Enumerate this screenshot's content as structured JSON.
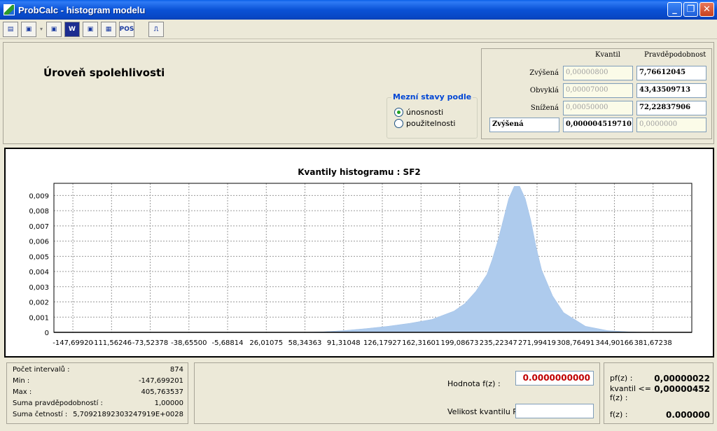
{
  "window": {
    "title": "ProbCalc - histogram modelu"
  },
  "toolbar": {
    "buttons": [
      "new-file-icon",
      "save-icon",
      "save-as-icon",
      "wiki-icon",
      "save-blue-icon",
      "report-icon",
      "pos-icon",
      "exit-icon"
    ],
    "pos_label": "POS"
  },
  "heading": "Úroveň spolehlivosti",
  "limit_states": {
    "title": "Mezní stavy podle",
    "options": [
      {
        "label": "únosnosti",
        "selected": true
      },
      {
        "label": "použitelnosti",
        "selected": false
      }
    ]
  },
  "quantile_table": {
    "col_kvantil": "Kvantil",
    "col_prob": "Pravděpodobnost",
    "rows": [
      {
        "label": "Zvýšená",
        "kvantil": "0,00000800",
        "prob": "7,76612045"
      },
      {
        "label": "Obvyklá",
        "kvantil": "0,00007000",
        "prob": "43,43509713"
      },
      {
        "label": "Snížená",
        "kvantil": "0,00050000",
        "prob": "72,22837906"
      }
    ],
    "selected_level": "Zvýšená",
    "selected_kvantil": "0,000004519710",
    "selected_prob": "0,0000000"
  },
  "chart_data": {
    "type": "area",
    "title": "Kvantily histogramu : SF2",
    "xlim": [
      -165,
      417
    ],
    "ylim": [
      0,
      0.0098
    ],
    "x_ticks": [
      "-147,69920",
      "-111,56246",
      "-73,52378",
      "-38,65500",
      "-5,68814",
      "26,01075",
      "58,34363",
      "91,31048",
      "126,17927",
      "162,31601",
      "199,08673",
      "235,22347",
      "271,99419",
      "308,76491",
      "344,90166",
      "381,67238"
    ],
    "y_ticks": [
      "0",
      "0,001",
      "0,002",
      "0,003",
      "0,004",
      "0,005",
      "0,006",
      "0,007",
      "0,008",
      "0,009"
    ],
    "grid": true,
    "x": [
      -147.7,
      58,
      80,
      100,
      120,
      140,
      160,
      180,
      200,
      210,
      220,
      230,
      235,
      240,
      245,
      250,
      255,
      260,
      265,
      270,
      275,
      280,
      290,
      300,
      320,
      340,
      360,
      380,
      405.76
    ],
    "y": [
      0,
      0,
      3e-05,
      0.00012,
      0.00025,
      0.0004,
      0.0006,
      0.00085,
      0.0014,
      0.0019,
      0.0027,
      0.0038,
      0.0048,
      0.006,
      0.0074,
      0.0088,
      0.0096,
      0.0096,
      0.0088,
      0.0074,
      0.0056,
      0.0041,
      0.0024,
      0.0013,
      0.0004,
      0.00012,
      3e-05,
      0,
      0
    ],
    "color": "#aecbed"
  },
  "stats": [
    {
      "label": "Počet intervalů :",
      "value": "874"
    },
    {
      "label": "Min :",
      "value": "-147,699201"
    },
    {
      "label": "Max :",
      "value": "405,763537"
    },
    {
      "label": "Suma pravděpodobností :",
      "value": "1,00000"
    },
    {
      "label": "Suma četností :",
      "value": "5,7092189230324791 9E+0028"
    }
  ],
  "stats_sum_freq": "5,70921892303247919E+0028",
  "inputs": {
    "hodnota_label": "Hodnota f(z) :",
    "hodnota_value": "0.0000000000",
    "velikost_label": "Velikost kvantilu P :",
    "velikost_value": ""
  },
  "results": [
    {
      "label": "pf(z) :",
      "value": "0,00000022"
    },
    {
      "label": "kvantil <= f(z) :",
      "value": "0,00000452"
    },
    {
      "label": "f(z) :",
      "value": "0.000000"
    }
  ]
}
